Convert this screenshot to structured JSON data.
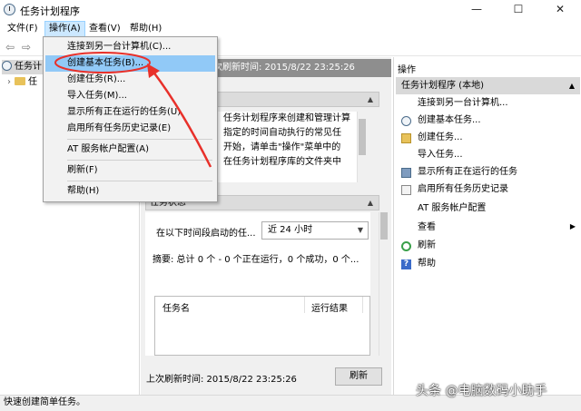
{
  "window": {
    "title": "任务计划程序",
    "controls": {
      "minimize": "—",
      "maximize": "☐",
      "close": "✕"
    }
  },
  "menubar": {
    "items": [
      {
        "label": "文件(F)"
      },
      {
        "label": "操作(A)"
      },
      {
        "label": "查看(V)"
      },
      {
        "label": "帮助(H)"
      }
    ]
  },
  "dropdown": {
    "items": [
      {
        "label": "连接到另一台计算机(C)..."
      },
      {
        "label": "创建基本任务(B)..."
      },
      {
        "label": "创建任务(R)..."
      },
      {
        "label": "导入任务(M)..."
      },
      {
        "label": "显示所有正在运行的任务(U)"
      },
      {
        "label": "启用所有任务历史记录(E)"
      },
      {
        "label": "AT 服务帐户配置(A)"
      },
      {
        "label": "刷新(F)"
      },
      {
        "label": "帮助(H)"
      }
    ]
  },
  "tree": {
    "root_label": "任务计",
    "child_label": "任"
  },
  "center": {
    "header_text": "次刷新时间: 2015/8/22 23:25:26",
    "overview_lines": [
      "任务计划程序来创建和管理计算",
      "指定的时间自动执行的常见任",
      "开始，请单击\"操作\"菜单中的",
      "",
      "在任务计划程序库的文件夹中"
    ],
    "status_section": "任务状态",
    "status_filter_label": "在以下时间段启动的任...",
    "status_filter_value": "近 24 小时",
    "summary": "摘要: 总计 0 个 - 0 个正在运行，0 个成功，0 个...",
    "table_headers": [
      "任务名",
      "运行结果"
    ],
    "footer_text": "上次刷新时间: 2015/8/22 23:25:26",
    "refresh_button": "刷新"
  },
  "actions": {
    "title": "操作",
    "subheader": "任务计划程序 (本地)",
    "items": [
      {
        "label": "连接到另一台计算机...",
        "icon": "none"
      },
      {
        "label": "创建基本任务...",
        "icon": "clock-icon"
      },
      {
        "label": "创建任务...",
        "icon": "task-icon"
      },
      {
        "label": "导入任务...",
        "icon": "none"
      },
      {
        "label": "显示所有正在运行的任务",
        "icon": "running-tasks-icon"
      },
      {
        "label": "启用所有任务历史记录",
        "icon": "history-icon"
      },
      {
        "label": "AT 服务帐户配置",
        "icon": "none"
      },
      {
        "label": "查看",
        "icon": "none"
      },
      {
        "label": "刷新",
        "icon": "refresh-icon"
      },
      {
        "label": "帮助",
        "icon": "help-icon"
      }
    ]
  },
  "statusbar": {
    "text": "快速创建简单任务。"
  },
  "watermark": {
    "text": "头条 @电脑数码小助手"
  },
  "colors": {
    "menu_highlight": "#91c9f7",
    "annotation_red": "#e8302a",
    "header_gray": "#8e8e8e"
  }
}
